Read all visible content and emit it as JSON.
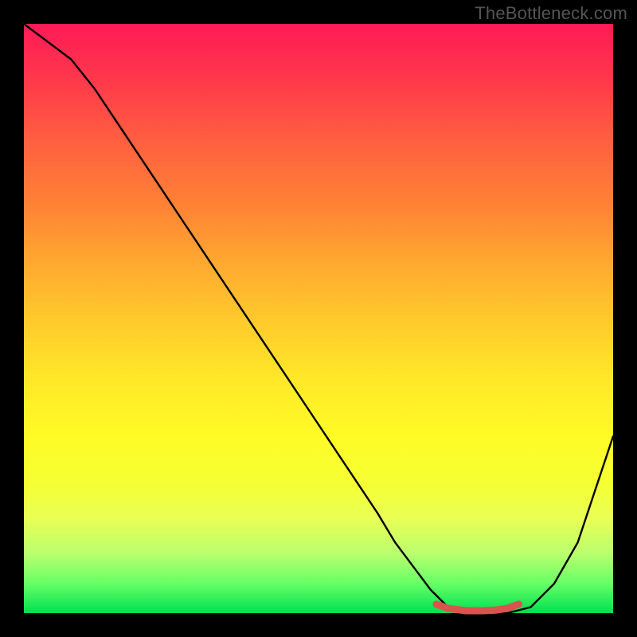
{
  "watermark": "TheBottleneck.com",
  "chart_data": {
    "type": "line",
    "title": "",
    "xlabel": "",
    "ylabel": "",
    "xlim": [
      0,
      100
    ],
    "ylim": [
      0,
      100
    ],
    "grid": false,
    "legend": false,
    "series": [
      {
        "name": "bottleneck-curve",
        "color": "#000000",
        "x": [
          0,
          4,
          8,
          12,
          16,
          20,
          24,
          28,
          32,
          36,
          40,
          44,
          48,
          52,
          56,
          60,
          63,
          66,
          69,
          72,
          75,
          78,
          82,
          86,
          90,
          94,
          100
        ],
        "y": [
          100,
          97,
          94,
          89,
          83,
          77,
          71,
          65,
          59,
          53,
          47,
          41,
          35,
          29,
          23,
          17,
          12,
          8,
          4,
          1,
          0,
          0,
          0,
          1,
          5,
          12,
          30
        ]
      },
      {
        "name": "optimal-zone-marker",
        "color": "#d9534f",
        "x": [
          70,
          72,
          75,
          78,
          80,
          82,
          84
        ],
        "y": [
          1.5,
          0.8,
          0.4,
          0.4,
          0.5,
          0.8,
          1.5
        ]
      }
    ],
    "annotations": []
  },
  "colors": {
    "frame": "#000000",
    "curve": "#000000",
    "marker": "#d9534f"
  }
}
